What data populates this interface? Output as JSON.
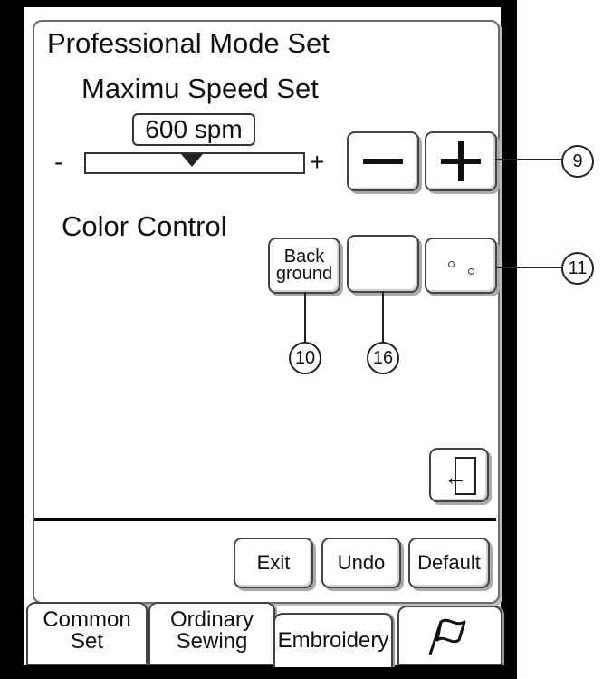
{
  "title": "Professional Mode Set",
  "speed": {
    "label": "Maximu Speed Set",
    "value": "600 spm",
    "slider_min_label": "-",
    "slider_max_label": "+",
    "slider_level_fraction": 0.5
  },
  "buttons": {
    "decrease_symbol": "−",
    "increase_symbol": "+",
    "background_line1": "Back",
    "background_line2": "ground",
    "exit": "Exit",
    "undo": "Undo",
    "default": "Default"
  },
  "color_control": {
    "label": "Color Control"
  },
  "callouts": {
    "c9": "9",
    "c10": "10",
    "c11": "11",
    "c16": "16"
  },
  "tabs": [
    {
      "line1": "Common",
      "line2": "Set"
    },
    {
      "line1": "Ordinary",
      "line2": "Sewing"
    },
    {
      "line1": "Embroidery",
      "line2": ""
    },
    {
      "icon": "flag-icon"
    }
  ],
  "colors": {
    "frame": "#000000",
    "screen": "#ffffff",
    "button_shadow": "#aaaaaa"
  }
}
